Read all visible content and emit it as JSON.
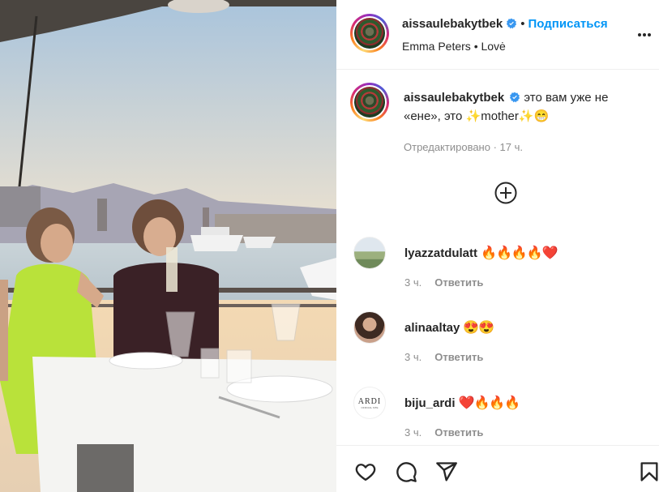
{
  "post": {
    "author": "aissaulebakytbek",
    "follow_label": "Подписаться",
    "location_line": "Emma Peters • Lovė",
    "caption_text": "это вам уже не «ене», это ✨mother✨😁",
    "caption_meta": "Отредактировано · 17 ч."
  },
  "comments": [
    {
      "username": "lyazzatdulatt",
      "emojis": "🔥🔥🔥🔥❤️",
      "time": "3 ч.",
      "reply_label": "Ответить"
    },
    {
      "username": "alinaaltay",
      "emojis": "😍😍",
      "time": "3 ч.",
      "reply_label": "Ответить"
    },
    {
      "username": "biju_ardi",
      "emojis": "❤️🔥🔥🔥",
      "time": "3 ч.",
      "reply_label": "Ответить",
      "avatar_text": "ARDI",
      "avatar_subtext": "OFFICIAL SITE"
    }
  ],
  "colors": {
    "accent": "#0095f6",
    "verified": "#3897f0",
    "muted": "#8e8e8e"
  },
  "icons": [
    "verified-badge-icon",
    "more-options-icon",
    "add-comment-icon",
    "heart-icon",
    "comment-icon",
    "share-icon",
    "bookmark-icon"
  ]
}
